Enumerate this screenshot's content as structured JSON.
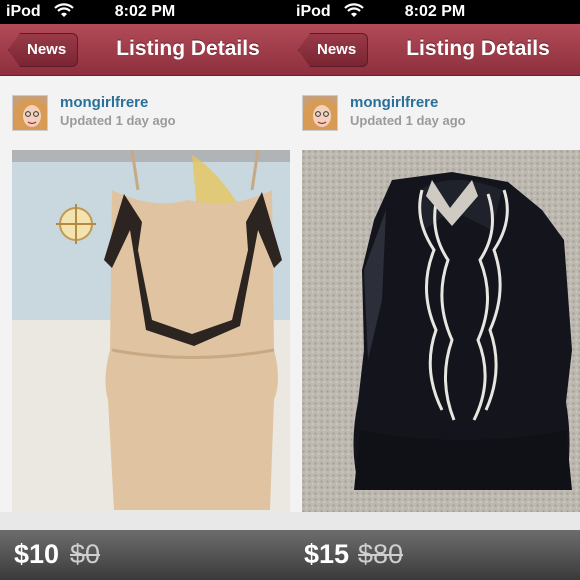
{
  "status": {
    "carrier": "iPod",
    "time": "8:02 PM"
  },
  "nav": {
    "back_label": "News",
    "title": "Listing Details"
  },
  "listings": [
    {
      "username": "mongirlfrere",
      "updated": "Updated 1 day ago",
      "photo_icon": "tan-ruffle-top-photo",
      "price": "$10",
      "original_price": "$0"
    },
    {
      "username": "mongirlfrere",
      "updated": "Updated 1 day ago",
      "photo_icon": "black-ruffle-blouse-photo",
      "price": "$15",
      "original_price": "$80"
    }
  ],
  "colors": {
    "nav": "#a33e4c",
    "link": "#2a6f9a",
    "price_bar": "#4a4a4a"
  }
}
